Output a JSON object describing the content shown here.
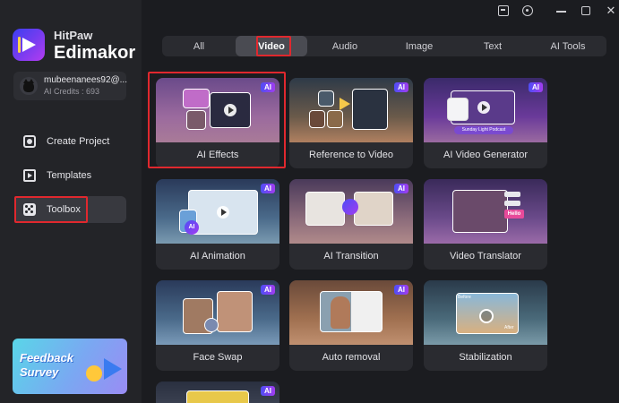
{
  "window": {
    "title_icons": [
      "message-icon",
      "help-icon",
      "minimize-icon",
      "maximize-icon",
      "close-icon"
    ]
  },
  "brand": {
    "top": "HitPaw",
    "main": "Edimakor"
  },
  "user": {
    "name": "mubeenanees92@...",
    "credits": "AI Credits : 693"
  },
  "sidebar": {
    "items": [
      {
        "label": "Create Project",
        "icon": "create-project-icon"
      },
      {
        "label": "Templates",
        "icon": "templates-icon"
      },
      {
        "label": "Toolbox",
        "icon": "toolbox-icon",
        "selected": true
      }
    ],
    "feedback": {
      "line1": "Feedback",
      "line2": "Survey"
    }
  },
  "tabs": {
    "items": [
      "All",
      "Video",
      "Audio",
      "Image",
      "Text",
      "AI Tools"
    ],
    "active": "Video"
  },
  "tools": {
    "badge": "AI",
    "items": [
      {
        "label": "AI Effects",
        "thumb_text": ""
      },
      {
        "label": "Reference to Video",
        "thumb_text": ""
      },
      {
        "label": "AI Video Generator",
        "thumb_text": "Sunday Light Podcast"
      },
      {
        "label": "AI Animation",
        "thumb_text": "AI"
      },
      {
        "label": "AI Transition",
        "thumb_text": ""
      },
      {
        "label": "Video Translator",
        "thumb_text": "Hello"
      },
      {
        "label": "Face Swap",
        "thumb_text": ""
      },
      {
        "label": "Auto removal",
        "thumb_text": ""
      },
      {
        "label": "Stabilization",
        "thumb_text_before": "Before",
        "thumb_text_after": "After"
      },
      {
        "label": "",
        "thumb_text": ""
      }
    ]
  },
  "colors": {
    "accent": "#7a3cf0",
    "highlight": "#e0282e",
    "background": "#1b1c20",
    "sidebar": "#232428"
  }
}
